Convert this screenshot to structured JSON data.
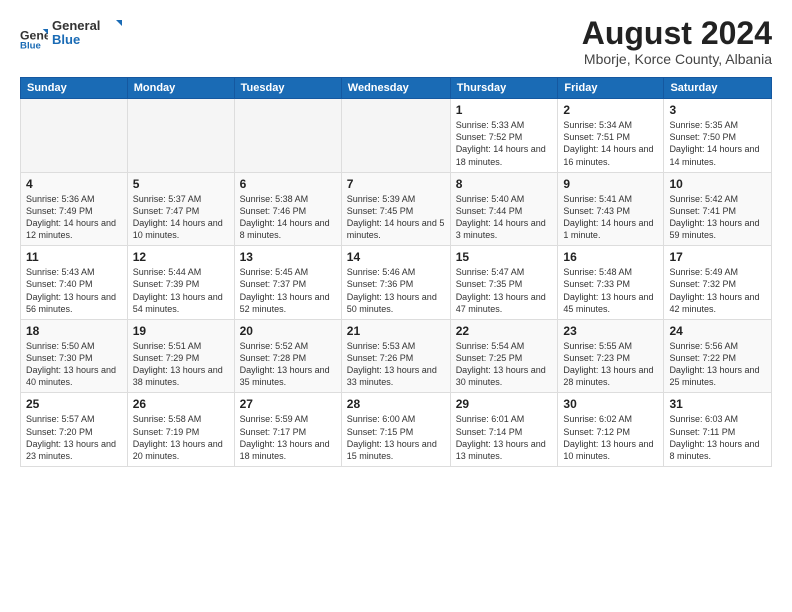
{
  "header": {
    "logo": {
      "general": "General",
      "blue": "Blue"
    },
    "title": "August 2024",
    "location": "Mborje, Korce County, Albania"
  },
  "weekdays": [
    "Sunday",
    "Monday",
    "Tuesday",
    "Wednesday",
    "Thursday",
    "Friday",
    "Saturday"
  ],
  "weeks": [
    [
      {
        "day": "",
        "empty": true
      },
      {
        "day": "",
        "empty": true
      },
      {
        "day": "",
        "empty": true
      },
      {
        "day": "",
        "empty": true
      },
      {
        "day": "1",
        "sunrise": "5:33 AM",
        "sunset": "7:52 PM",
        "daylight": "14 hours and 18 minutes."
      },
      {
        "day": "2",
        "sunrise": "5:34 AM",
        "sunset": "7:51 PM",
        "daylight": "14 hours and 16 minutes."
      },
      {
        "day": "3",
        "sunrise": "5:35 AM",
        "sunset": "7:50 PM",
        "daylight": "14 hours and 14 minutes."
      }
    ],
    [
      {
        "day": "4",
        "sunrise": "5:36 AM",
        "sunset": "7:49 PM",
        "daylight": "14 hours and 12 minutes."
      },
      {
        "day": "5",
        "sunrise": "5:37 AM",
        "sunset": "7:47 PM",
        "daylight": "14 hours and 10 minutes."
      },
      {
        "day": "6",
        "sunrise": "5:38 AM",
        "sunset": "7:46 PM",
        "daylight": "14 hours and 8 minutes."
      },
      {
        "day": "7",
        "sunrise": "5:39 AM",
        "sunset": "7:45 PM",
        "daylight": "14 hours and 5 minutes."
      },
      {
        "day": "8",
        "sunrise": "5:40 AM",
        "sunset": "7:44 PM",
        "daylight": "14 hours and 3 minutes."
      },
      {
        "day": "9",
        "sunrise": "5:41 AM",
        "sunset": "7:43 PM",
        "daylight": "14 hours and 1 minute."
      },
      {
        "day": "10",
        "sunrise": "5:42 AM",
        "sunset": "7:41 PM",
        "daylight": "13 hours and 59 minutes."
      }
    ],
    [
      {
        "day": "11",
        "sunrise": "5:43 AM",
        "sunset": "7:40 PM",
        "daylight": "13 hours and 56 minutes."
      },
      {
        "day": "12",
        "sunrise": "5:44 AM",
        "sunset": "7:39 PM",
        "daylight": "13 hours and 54 minutes."
      },
      {
        "day": "13",
        "sunrise": "5:45 AM",
        "sunset": "7:37 PM",
        "daylight": "13 hours and 52 minutes."
      },
      {
        "day": "14",
        "sunrise": "5:46 AM",
        "sunset": "7:36 PM",
        "daylight": "13 hours and 50 minutes."
      },
      {
        "day": "15",
        "sunrise": "5:47 AM",
        "sunset": "7:35 PM",
        "daylight": "13 hours and 47 minutes."
      },
      {
        "day": "16",
        "sunrise": "5:48 AM",
        "sunset": "7:33 PM",
        "daylight": "13 hours and 45 minutes."
      },
      {
        "day": "17",
        "sunrise": "5:49 AM",
        "sunset": "7:32 PM",
        "daylight": "13 hours and 42 minutes."
      }
    ],
    [
      {
        "day": "18",
        "sunrise": "5:50 AM",
        "sunset": "7:30 PM",
        "daylight": "13 hours and 40 minutes."
      },
      {
        "day": "19",
        "sunrise": "5:51 AM",
        "sunset": "7:29 PM",
        "daylight": "13 hours and 38 minutes."
      },
      {
        "day": "20",
        "sunrise": "5:52 AM",
        "sunset": "7:28 PM",
        "daylight": "13 hours and 35 minutes."
      },
      {
        "day": "21",
        "sunrise": "5:53 AM",
        "sunset": "7:26 PM",
        "daylight": "13 hours and 33 minutes."
      },
      {
        "day": "22",
        "sunrise": "5:54 AM",
        "sunset": "7:25 PM",
        "daylight": "13 hours and 30 minutes."
      },
      {
        "day": "23",
        "sunrise": "5:55 AM",
        "sunset": "7:23 PM",
        "daylight": "13 hours and 28 minutes."
      },
      {
        "day": "24",
        "sunrise": "5:56 AM",
        "sunset": "7:22 PM",
        "daylight": "13 hours and 25 minutes."
      }
    ],
    [
      {
        "day": "25",
        "sunrise": "5:57 AM",
        "sunset": "7:20 PM",
        "daylight": "13 hours and 23 minutes."
      },
      {
        "day": "26",
        "sunrise": "5:58 AM",
        "sunset": "7:19 PM",
        "daylight": "13 hours and 20 minutes."
      },
      {
        "day": "27",
        "sunrise": "5:59 AM",
        "sunset": "7:17 PM",
        "daylight": "13 hours and 18 minutes."
      },
      {
        "day": "28",
        "sunrise": "6:00 AM",
        "sunset": "7:15 PM",
        "daylight": "13 hours and 15 minutes."
      },
      {
        "day": "29",
        "sunrise": "6:01 AM",
        "sunset": "7:14 PM",
        "daylight": "13 hours and 13 minutes."
      },
      {
        "day": "30",
        "sunrise": "6:02 AM",
        "sunset": "7:12 PM",
        "daylight": "13 hours and 10 minutes."
      },
      {
        "day": "31",
        "sunrise": "6:03 AM",
        "sunset": "7:11 PM",
        "daylight": "13 hours and 8 minutes."
      }
    ]
  ]
}
